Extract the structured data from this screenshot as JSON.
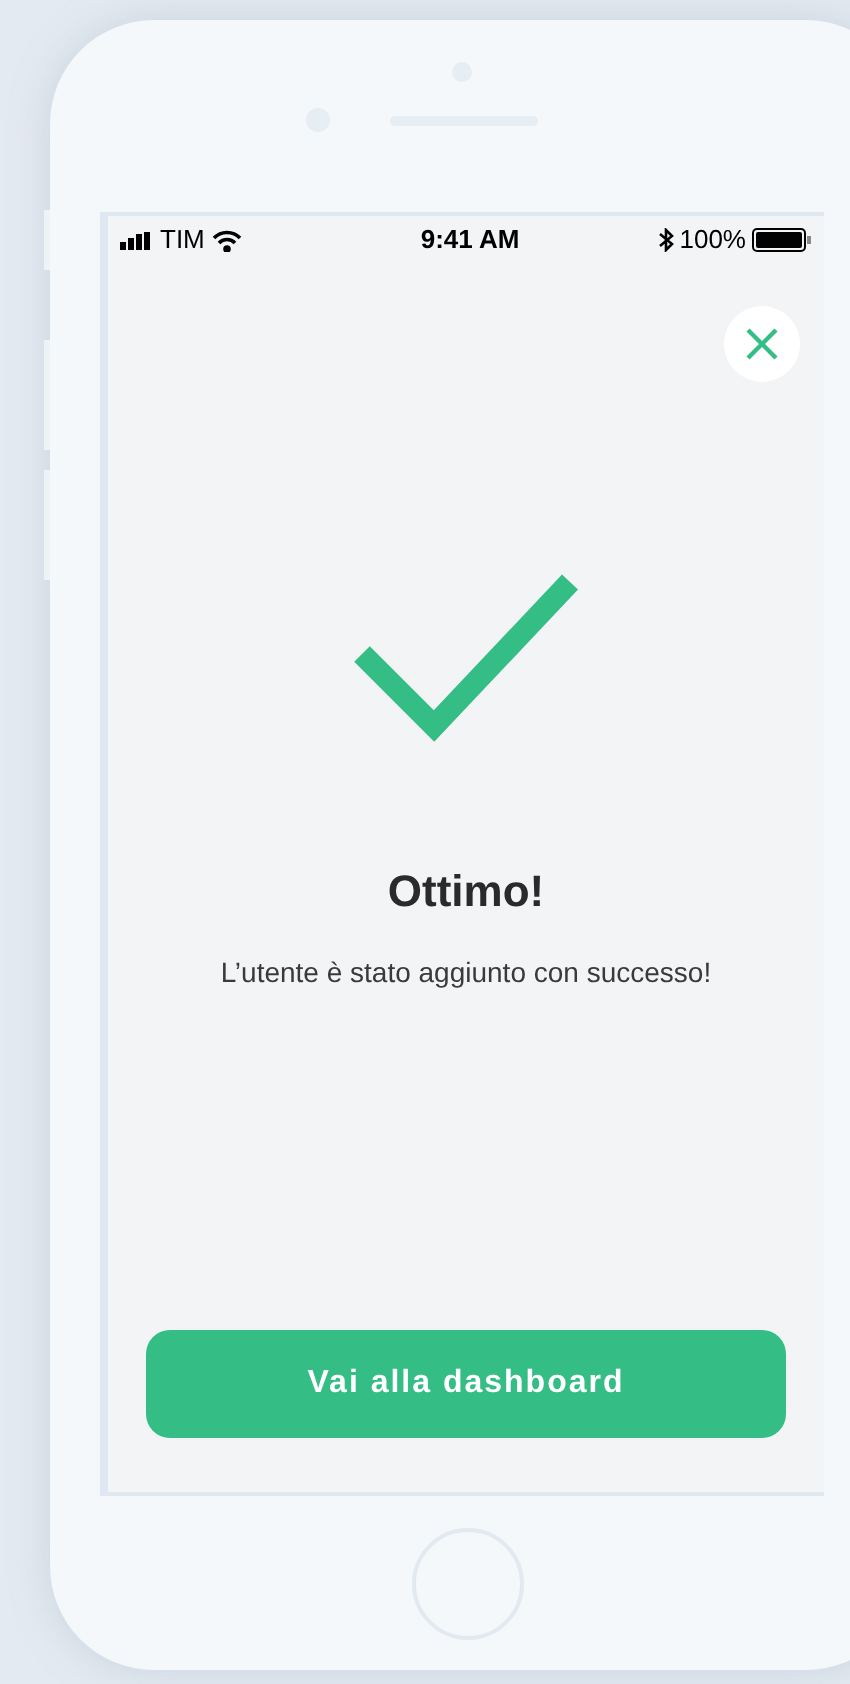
{
  "status_bar": {
    "carrier": "TIM",
    "time": "9:41 AM",
    "battery": "100%"
  },
  "dialog": {
    "title": "Ottimo!",
    "message": "L’utente è stato aggiunto con successo!",
    "button": "Vai alla dashboard"
  }
}
